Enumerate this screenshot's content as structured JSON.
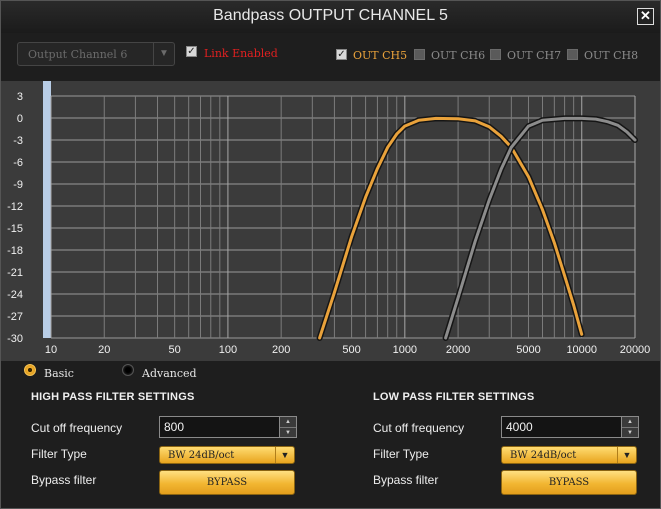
{
  "window": {
    "title": "Bandpass OUTPUT CHANNEL 5",
    "close_symbol": "✕"
  },
  "channel_select": {
    "value": "Output Channel 6",
    "arrow": "▼"
  },
  "link": {
    "label": "Link Enabled",
    "checked": true,
    "color": "#e02020"
  },
  "outputs": [
    {
      "label": "OUT CH5",
      "checked": true,
      "color": "#e9a23b"
    },
    {
      "label": "OUT CH6",
      "checked": false,
      "color": "#8a8a8a"
    },
    {
      "label": "OUT CH7",
      "checked": false,
      "color": "#8a8a8a"
    },
    {
      "label": "OUT CH8",
      "checked": false,
      "color": "#8a8a8a"
    }
  ],
  "chart_data": {
    "type": "line",
    "x_scale": "log",
    "xlim": [
      10,
      20000
    ],
    "ylim": [
      -30,
      3
    ],
    "grid": true,
    "y_ticks": [
      3,
      0,
      -3,
      -6,
      -9,
      -12,
      -15,
      -18,
      -21,
      -24,
      -27,
      -30
    ],
    "x_tick_labels": [
      {
        "value": 10,
        "label": "10"
      },
      {
        "value": 20,
        "label": "20"
      },
      {
        "value": 50,
        "label": "50"
      },
      {
        "value": 100,
        "label": "100"
      },
      {
        "value": 200,
        "label": "200"
      },
      {
        "value": 500,
        "label": "500"
      },
      {
        "value": 1000,
        "label": "1000"
      },
      {
        "value": 2000,
        "label": "2000"
      },
      {
        "value": 5000,
        "label": "5000"
      },
      {
        "value": 10000,
        "label": "10000"
      },
      {
        "value": 20000,
        "label": "20000"
      }
    ],
    "series": [
      {
        "color": "#e9a23b",
        "x": [
          330,
          400,
          500,
          600,
          700,
          800,
          900,
          1000,
          1200,
          1500,
          2000,
          2500,
          3000,
          3500,
          4000,
          5000,
          6000,
          7000,
          8000,
          9000,
          10000
        ],
        "y": [
          -30,
          -23.8,
          -16.2,
          -10.8,
          -6.9,
          -4.0,
          -2.2,
          -1.1,
          -0.3,
          -0.05,
          -0.1,
          -0.4,
          -1.2,
          -2.5,
          -4.0,
          -8.0,
          -12.5,
          -17.0,
          -21.5,
          -25.5,
          -29.5
        ]
      },
      {
        "color": "#8c8c8c",
        "x": [
          1700,
          2000,
          2500,
          3000,
          3500,
          4000,
          5000,
          6000,
          8000,
          10000,
          12000,
          14000,
          16000,
          18000,
          20000
        ],
        "y": [
          -30,
          -24.5,
          -16.8,
          -11.2,
          -7.0,
          -4.0,
          -1.1,
          -0.3,
          -0.05,
          -0.05,
          -0.15,
          -0.5,
          -1.0,
          -1.9,
          -3.0
        ]
      }
    ]
  },
  "mode": {
    "basic_label": "Basic",
    "advanced_label": "Advanced",
    "selected": "basic"
  },
  "high_pass": {
    "heading": "HIGH PASS FILTER SETTINGS",
    "cutoff_label": "Cut off frequency",
    "cutoff_value": "800",
    "type_label": "Filter Type",
    "type_value": "BW 24dB/oct",
    "bypass_label": "Bypass filter",
    "bypass_button": "BYPASS"
  },
  "low_pass": {
    "heading": "LOW PASS FILTER SETTINGS",
    "cutoff_label": "Cut off frequency",
    "cutoff_value": "4000",
    "type_label": "Filter Type",
    "type_value": "BW 24dB/oct",
    "bypass_label": "Bypass filter",
    "bypass_button": "BYPASS"
  },
  "icons": {
    "spin_up": "▲",
    "spin_down": "▼",
    "dropdown_arrow": "▼",
    "check": "✓"
  }
}
